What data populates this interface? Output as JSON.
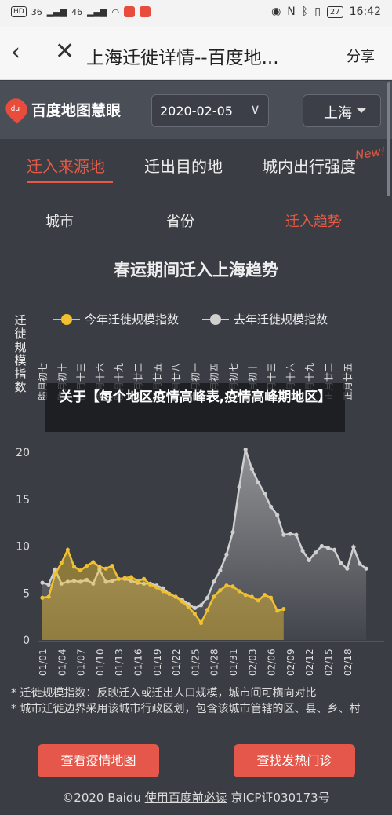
{
  "status_bar": {
    "left": [
      "HD",
      "36",
      "46"
    ],
    "battery": "27",
    "time": "16:42"
  },
  "nav": {
    "title": "上海迁徙详情--百度地...",
    "share": "分享"
  },
  "app": {
    "logo_text": "百度地图慧眼",
    "logo_badge": "du",
    "date": "2020-02-05",
    "city": "上海"
  },
  "tabs": [
    {
      "label": "迁入来源地"
    },
    {
      "label": "迁出目的地"
    },
    {
      "label": "城内出行强度"
    }
  ],
  "new_badge": "New!",
  "subtabs": [
    {
      "label": "城市"
    },
    {
      "label": "省份"
    },
    {
      "label": "迁入趋势"
    }
  ],
  "overlay": {
    "text": "关于【每个地区疫情高峰表,疫情高峰期地区】"
  },
  "notes": [
    "* 迁徙规模指数：反映迁入或迁出人口规模，城市间可横向对比",
    "* 城市迁徙边界采用该城市行政区划，包含该城市管辖的区、县、乡、村"
  ],
  "buttons": {
    "epidemic_map": "查看疫情地图",
    "fever_clinic": "查找发热门诊"
  },
  "footer": {
    "copyright": "©2020 Baidu",
    "terms": "使用百度前必读",
    "icp": "京ICP证030173号"
  },
  "colors": {
    "accent": "#e55a45",
    "this_year": "#f0c030",
    "last_year": "#cfcfcf"
  },
  "chart_data": {
    "type": "line",
    "title": "春运期间迁入上海趋势",
    "ylabel": "迁徙规模指数",
    "ylim": [
      0,
      25
    ],
    "yticks": [
      0,
      5,
      10,
      15,
      20
    ],
    "legend_position": "top",
    "lunar_labels": [
      "腊月初七",
      "腊月初十",
      "腊月十三",
      "腊月十六",
      "腊月十九",
      "腊月廿二",
      "腊月廿五",
      "腊月廿八",
      "正月初一",
      "正月初四",
      "正月初七",
      "正月初十",
      "正月十三",
      "正月十六",
      "正月十九",
      "正月廿二",
      "正月廿五"
    ],
    "x_tick_labels": [
      "01/01",
      "01/04",
      "01/07",
      "01/10",
      "01/13",
      "01/16",
      "01/19",
      "01/22",
      "01/25",
      "01/28",
      "01/31",
      "02/03",
      "02/06",
      "02/09",
      "02/12",
      "02/15",
      "02/18"
    ],
    "x_dates": [
      "01/01",
      "01/02",
      "01/03",
      "01/04",
      "01/05",
      "01/06",
      "01/07",
      "01/08",
      "01/09",
      "01/10",
      "01/11",
      "01/12",
      "01/13",
      "01/14",
      "01/15",
      "01/16",
      "01/17",
      "01/18",
      "01/19",
      "01/20",
      "01/21",
      "01/22",
      "01/23",
      "01/24",
      "01/25",
      "01/26",
      "01/27",
      "01/28",
      "01/29",
      "01/30",
      "01/31",
      "02/01",
      "02/02",
      "02/03",
      "02/04",
      "02/05",
      "02/06",
      "02/07",
      "02/08",
      "02/09",
      "02/10",
      "02/11",
      "02/12",
      "02/13",
      "02/14",
      "02/15",
      "02/16",
      "02/17",
      "02/18",
      "02/19"
    ],
    "series": [
      {
        "name": "今年迁徙规模指数",
        "color": "#f0c030",
        "values": [
          4.5,
          4.6,
          7.0,
          8.2,
          9.6,
          7.8,
          7.4,
          7.9,
          8.3,
          7.8,
          7.6,
          7.9,
          6.5,
          6.6,
          6.7,
          6.3,
          6.5,
          5.9,
          5.6,
          5.2,
          4.9,
          4.6,
          4.1,
          3.5,
          2.8,
          1.8,
          3.2,
          4.6,
          5.3,
          5.8,
          5.7,
          5.2,
          4.8,
          4.6,
          4.2,
          4.8,
          4.5,
          3.1,
          3.3
        ]
      },
      {
        "name": "去年迁徙规模指数",
        "color": "#cfcfcf",
        "values": [
          6.1,
          5.9,
          7.5,
          6.0,
          6.2,
          6.3,
          6.2,
          6.4,
          6.0,
          7.5,
          6.2,
          6.3,
          6.5,
          6.5,
          6.3,
          6.1,
          6.0,
          6.0,
          5.8,
          5.5,
          4.9,
          4.6,
          4.3,
          3.8,
          3.4,
          3.7,
          4.5,
          6.2,
          7.4,
          9.1,
          11.5,
          16.3,
          20.3,
          18.2,
          16.8,
          15.6,
          14.2,
          13.3,
          11.2,
          11.3,
          11.2,
          9.5,
          8.5,
          9.3,
          10.0,
          9.8,
          9.6,
          8.2,
          7.6,
          9.9,
          8.1,
          7.6
        ]
      }
    ]
  }
}
